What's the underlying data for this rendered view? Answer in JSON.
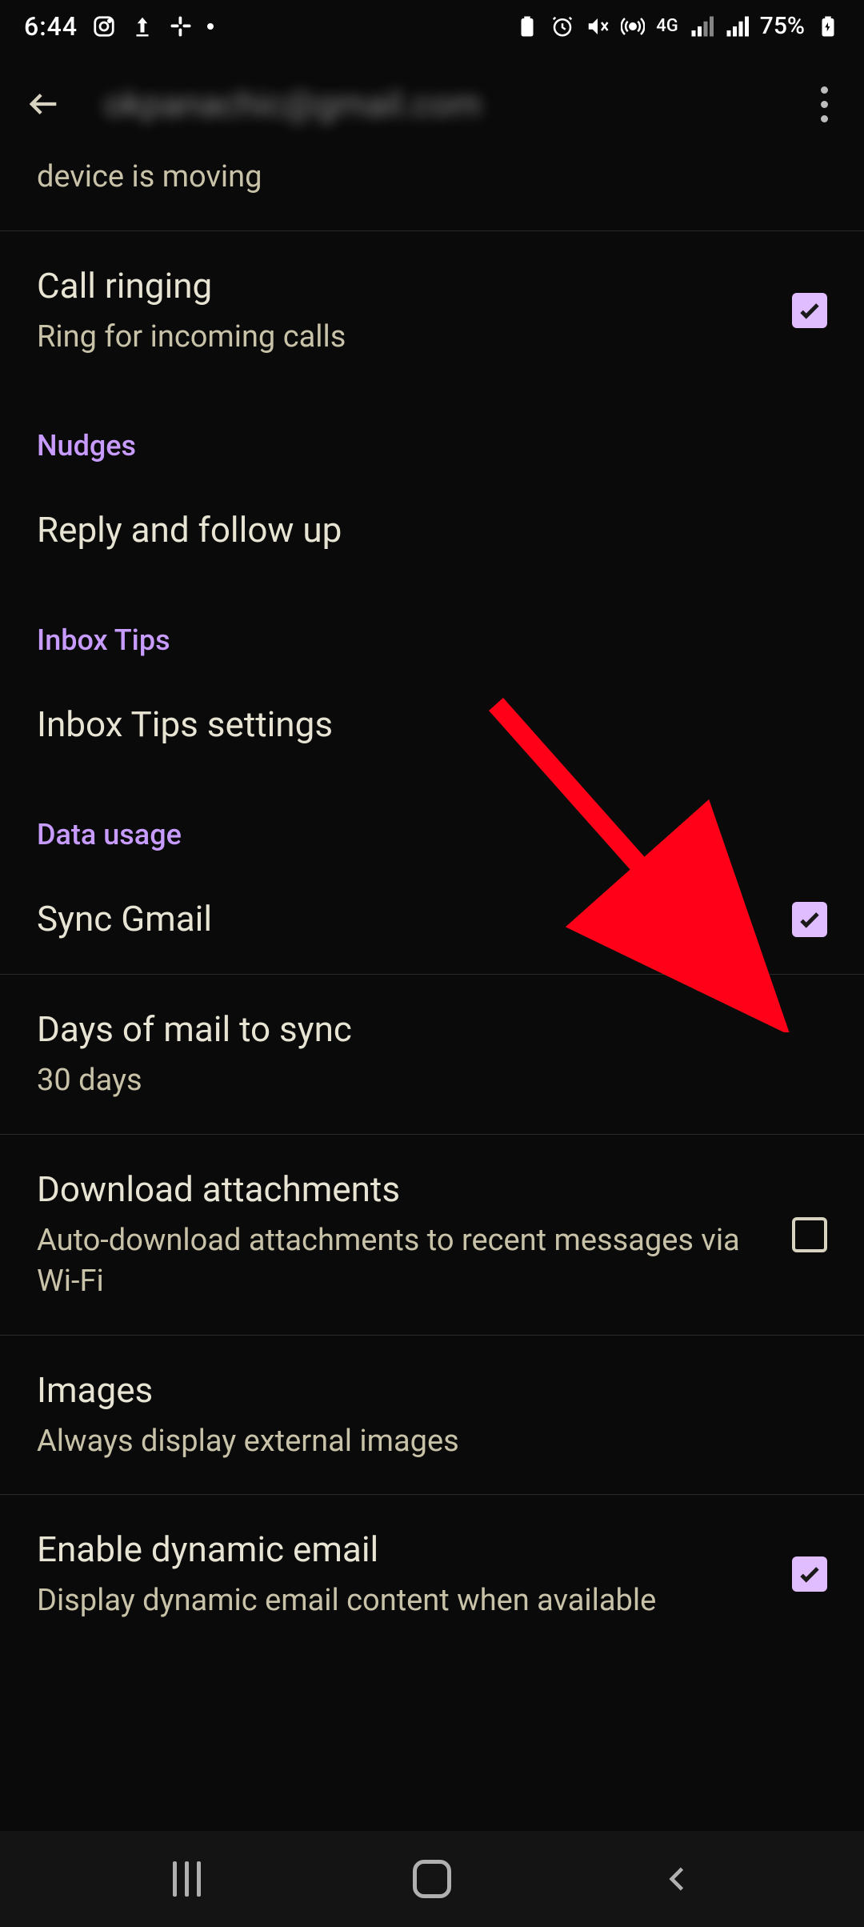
{
  "status": {
    "time": "6:44",
    "network_type": "4G",
    "battery": "75%"
  },
  "appbar": {
    "account": "okpanachic@gmail.com"
  },
  "partial_row": {
    "subtitle_fragment": "device is moving"
  },
  "rows": {
    "call_ringing": {
      "title": "Call ringing",
      "subtitle": "Ring for incoming calls",
      "checked": true
    },
    "nudges_header": "Nudges",
    "reply_follow": {
      "title": "Reply and follow up"
    },
    "inbox_tips_header": "Inbox Tips",
    "inbox_tips_settings": {
      "title": "Inbox Tips settings"
    },
    "data_usage_header": "Data usage",
    "sync_gmail": {
      "title": "Sync Gmail",
      "checked": true
    },
    "days_sync": {
      "title": "Days of mail to sync",
      "subtitle": "30 days"
    },
    "download_att": {
      "title": "Download attachments",
      "subtitle": "Auto-download attachments to recent messages via Wi-Fi",
      "checked": false
    },
    "images": {
      "title": "Images",
      "subtitle": "Always display external images"
    },
    "dynamic_email": {
      "title": "Enable dynamic email",
      "subtitle": "Display dynamic email content when available",
      "checked": true
    }
  },
  "annotation": {
    "color": "#ff0018"
  }
}
